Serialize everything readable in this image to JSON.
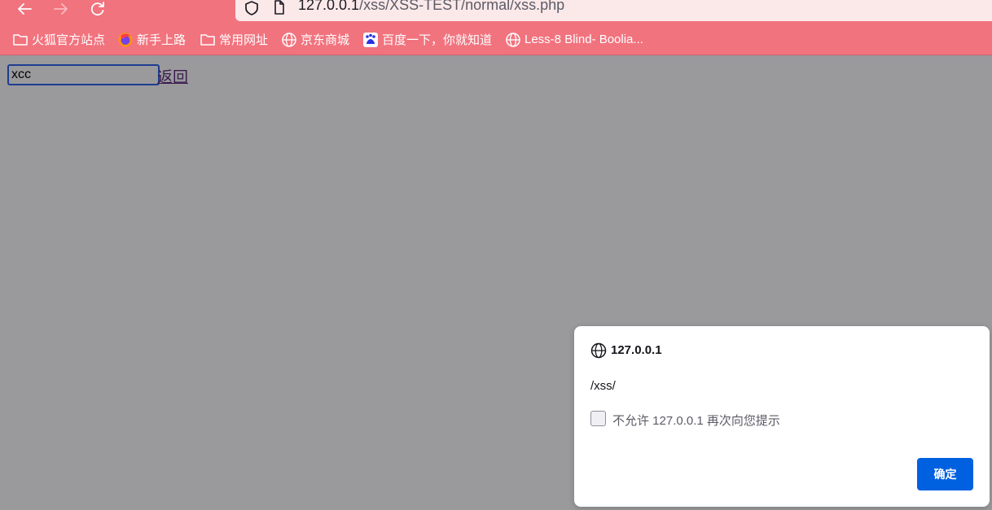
{
  "browser": {
    "url": {
      "host": "127.0.0.1",
      "path": "/xss/XSS-TEST/normal/xss.php"
    },
    "bookmarks": [
      {
        "label": "火狐官方站点",
        "icon": "folder-icon"
      },
      {
        "label": "新手上路",
        "icon": "firefox-icon"
      },
      {
        "label": "常用网址",
        "icon": "folder-icon"
      },
      {
        "label": "京东商城",
        "icon": "globe-icon"
      },
      {
        "label": "百度一下，你就知道",
        "icon": "baidu-icon"
      },
      {
        "label": "Less-8 Blind- Boolia...",
        "icon": "globe-icon"
      }
    ],
    "toolbar_color": "#f1737e"
  },
  "page": {
    "input_value": "xcc",
    "back_link": "返回"
  },
  "dialog": {
    "origin": "127.0.0.1",
    "message": "/xss/",
    "checkbox_label": "不允许 127.0.0.1 再次向您提示",
    "ok_label": "确定",
    "ok_color": "#0061e0"
  }
}
